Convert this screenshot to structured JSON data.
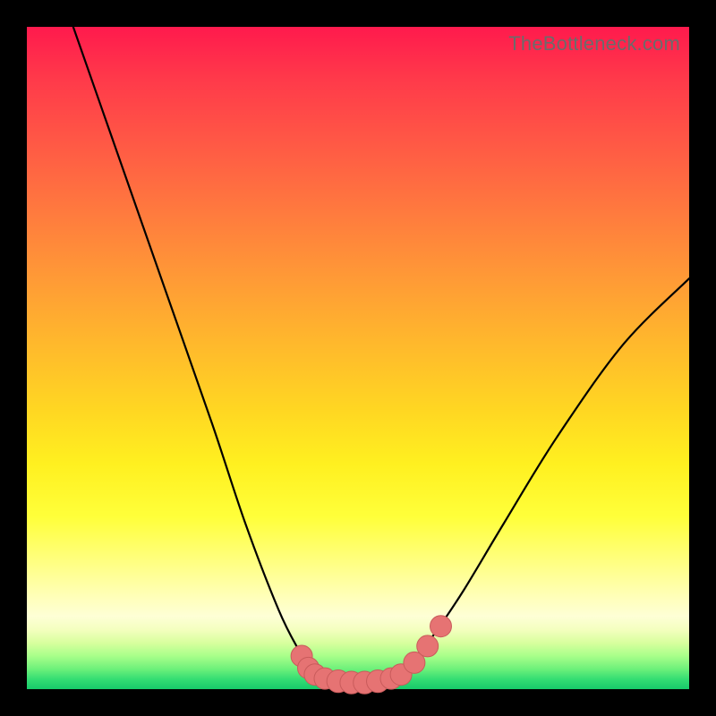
{
  "watermark": "TheBottleneck.com",
  "colors": {
    "marker_fill": "#e67373",
    "marker_stroke": "#c95b5b",
    "curve": "#000000"
  },
  "chart_data": {
    "type": "line",
    "title": "",
    "xlabel": "",
    "ylabel": "",
    "xlim": [
      0,
      100
    ],
    "ylim": [
      0,
      100
    ],
    "grid": false,
    "legend": false,
    "curve_points": [
      {
        "x": 7,
        "y": 100
      },
      {
        "x": 14,
        "y": 80
      },
      {
        "x": 21,
        "y": 60
      },
      {
        "x": 28,
        "y": 40
      },
      {
        "x": 33,
        "y": 25
      },
      {
        "x": 38,
        "y": 12
      },
      {
        "x": 41,
        "y": 6
      },
      {
        "x": 43,
        "y": 3
      },
      {
        "x": 45,
        "y": 1.8
      },
      {
        "x": 47,
        "y": 1.2
      },
      {
        "x": 49,
        "y": 1.0
      },
      {
        "x": 51,
        "y": 1.0
      },
      {
        "x": 53,
        "y": 1.2
      },
      {
        "x": 55,
        "y": 1.8
      },
      {
        "x": 57,
        "y": 3
      },
      {
        "x": 59,
        "y": 5
      },
      {
        "x": 62,
        "y": 9
      },
      {
        "x": 66,
        "y": 15
      },
      {
        "x": 72,
        "y": 25
      },
      {
        "x": 80,
        "y": 38
      },
      {
        "x": 90,
        "y": 52
      },
      {
        "x": 100,
        "y": 62
      }
    ],
    "markers": [
      {
        "x": 41.5,
        "y": 5.0,
        "r": 1.2
      },
      {
        "x": 42.5,
        "y": 3.2,
        "r": 1.2
      },
      {
        "x": 43.5,
        "y": 2.2,
        "r": 1.2
      },
      {
        "x": 45.0,
        "y": 1.6,
        "r": 1.2
      },
      {
        "x": 47.0,
        "y": 1.2,
        "r": 1.3
      },
      {
        "x": 49.0,
        "y": 1.0,
        "r": 1.3
      },
      {
        "x": 51.0,
        "y": 1.0,
        "r": 1.3
      },
      {
        "x": 53.0,
        "y": 1.2,
        "r": 1.3
      },
      {
        "x": 55.0,
        "y": 1.6,
        "r": 1.2
      },
      {
        "x": 56.5,
        "y": 2.2,
        "r": 1.2
      },
      {
        "x": 58.5,
        "y": 4.0,
        "r": 1.2
      },
      {
        "x": 60.5,
        "y": 6.5,
        "r": 1.2
      },
      {
        "x": 62.5,
        "y": 9.5,
        "r": 1.2
      }
    ]
  }
}
